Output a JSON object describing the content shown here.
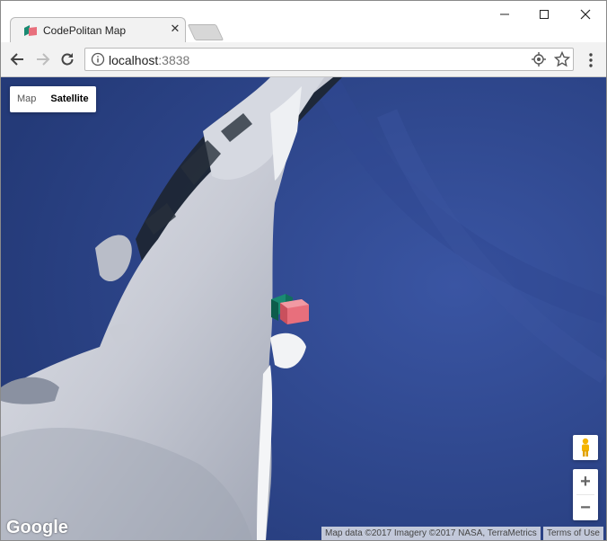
{
  "tab": {
    "title": "CodePolitan Map",
    "close_glyph": "✕"
  },
  "window_controls": {
    "minimize": "—",
    "maximize": "☐",
    "close": "✕"
  },
  "omnibox": {
    "host": "localhost",
    "port": ":3838"
  },
  "map_type": {
    "map_label": "Map",
    "satellite_label": "Satellite",
    "selected": "Satellite"
  },
  "zoom": {
    "in_label": "+",
    "out_label": "−"
  },
  "footer": {
    "logo": "Google",
    "attribution": "Map data ©2017 Imagery ©2017 NASA, TerraMetrics",
    "terms": "Terms of Use"
  },
  "colors": {
    "ocean": "#2e4587",
    "ice": "#c8ccd6",
    "marker_green": "#1a8a72",
    "marker_pink": "#e86f7c"
  },
  "icons": [
    "back-arrow-icon",
    "forward-arrow-icon",
    "reload-icon",
    "info-icon",
    "location-icon",
    "star-icon",
    "menu-icon",
    "pegman-icon",
    "map-marker-icon"
  ]
}
